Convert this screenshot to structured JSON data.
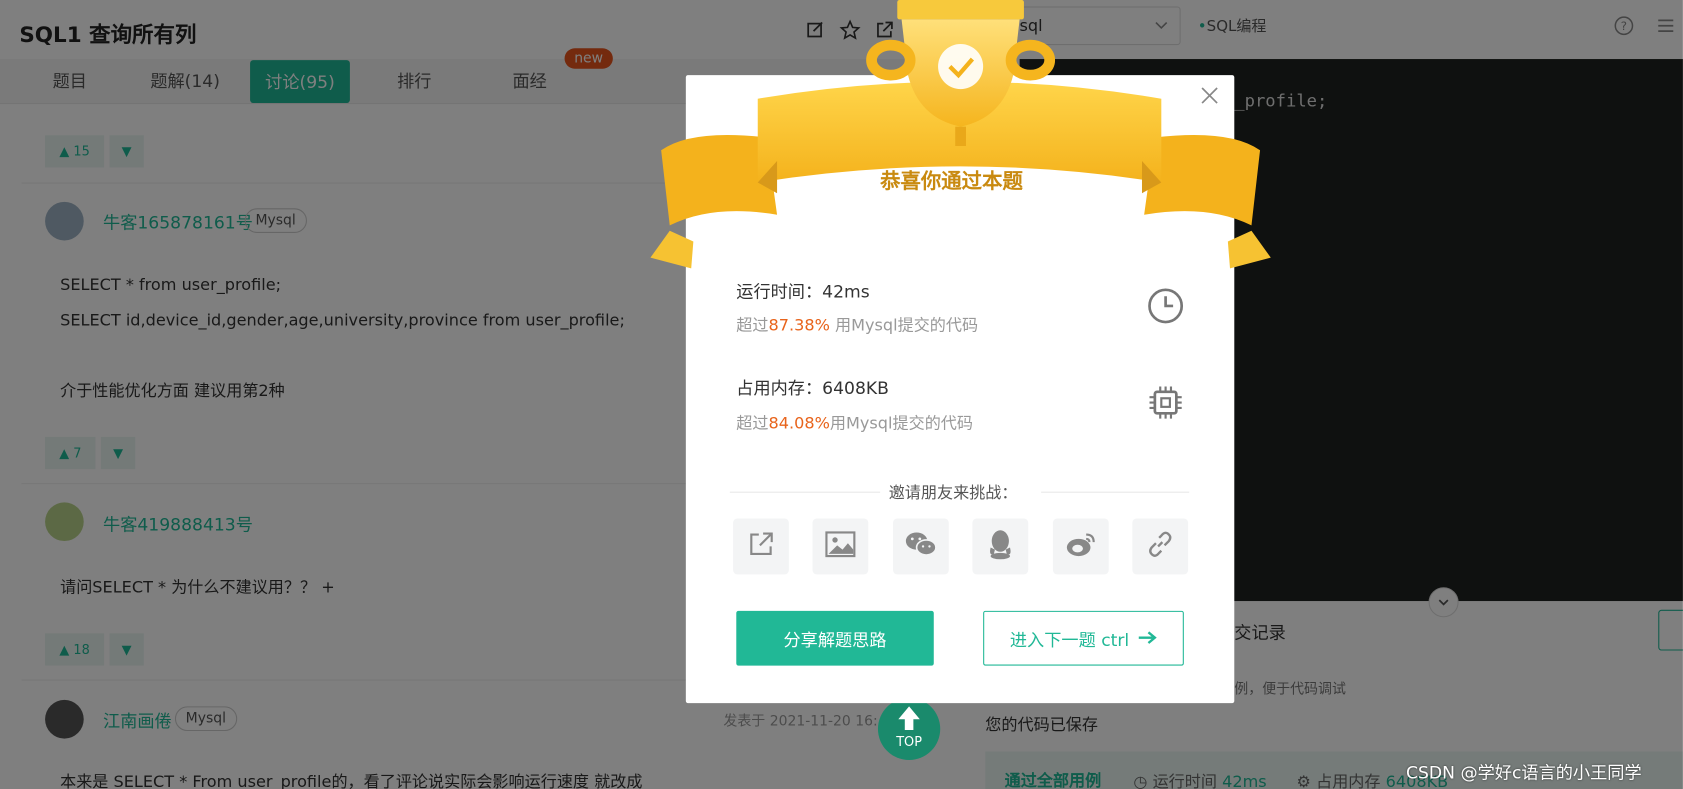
{
  "header": {
    "title": "SQL1 查询所有列",
    "lang_select": "ysql",
    "lang_link": "SQL编程"
  },
  "tabs": [
    {
      "label": "题目"
    },
    {
      "label": "题解(14)"
    },
    {
      "label": "讨论(95)"
    },
    {
      "label": "排行"
    },
    {
      "label": "面经"
    }
  ],
  "new_badge": "new",
  "posts": [
    {
      "votes": "15"
    },
    {
      "user": "牛客165878161号",
      "tag": "Mysql",
      "lines": [
        "SELECT * from user_profile;",
        "SELECT id,device_id,gender,age,university,province from user_profile;",
        "介于性能优化方面 建议用第2种"
      ],
      "votes": "7"
    },
    {
      "user": "牛客419888413号",
      "lines": [
        "请问SELECT * 为什么不建议用？？ +"
      ],
      "votes": "18"
    },
    {
      "user": "江南画倦",
      "tag": "Mysql",
      "date": "发表于 2021-11-20 16:",
      "lines": [
        "本来是 SELECT * From user_profile的，看了评论说实际会影响运行速度 就改成"
      ]
    }
  ],
  "editor": {
    "code_line": "_profile;"
  },
  "bottom": {
    "tab_label": "交记录",
    "hint": "例，便于代码调试",
    "saved": "您的代码已保存",
    "status": "通过全部用例",
    "time_label": "运行时间",
    "time_value": "42ms",
    "mem_label": "占用内存",
    "mem_value": "6408KB"
  },
  "top_button": "TOP",
  "watermark": "CSDN @学好c语言的小王同学",
  "modal": {
    "banner": "恭喜你通过本题",
    "runtime_label": "运行时间：",
    "runtime_value": "42ms",
    "runtime_pre": "超过",
    "runtime_pct": "87.38%",
    "runtime_post": " 用Mysql提交的代码",
    "memory_label": "占用内存：",
    "memory_value": "6408KB",
    "memory_pre": "超过",
    "memory_pct": "84.08%",
    "memory_post": "用Mysql提交的代码",
    "invite": "邀请朋友来挑战：",
    "share_button": "分享解题思路",
    "next_button": "进入下一题 ctrl"
  },
  "colors": {
    "accent": "#21b896",
    "highlight": "#e8641c",
    "gold": "#f7c93c"
  }
}
